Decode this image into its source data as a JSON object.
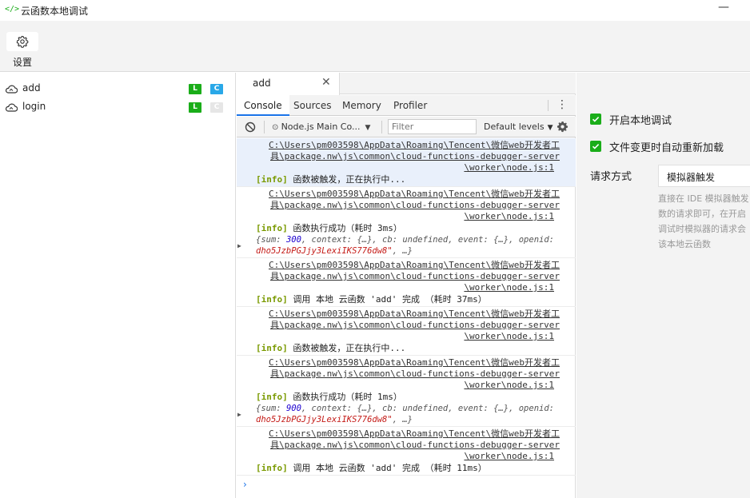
{
  "titlebar": {
    "icon": "code-bracket-icon",
    "icon_glyph": "</>",
    "title": "云函数本地调试",
    "minimize_glyph": "—"
  },
  "toolbar": {
    "settings_label": "设置",
    "settings_icon": "gear-icon"
  },
  "sidebar": {
    "functions": [
      {
        "name": "add",
        "badge_l": "L",
        "badge_c": "C",
        "c_enabled": true
      },
      {
        "name": "login",
        "badge_l": "L",
        "badge_c": "C",
        "c_enabled": false
      }
    ],
    "colors": {
      "local": "#1aad19",
      "cloud": "#29a8e8",
      "cloud_disabled": "#e6e6e6"
    }
  },
  "editor": {
    "tab_label": "add",
    "close_glyph": "✕"
  },
  "devtools": {
    "tabs": [
      "Console",
      "Sources",
      "Memory",
      "Profiler"
    ],
    "active_tab": "Console",
    "context_label": "Node.js Main Co...",
    "filter_placeholder": "Filter",
    "levels_label": "Default levels",
    "kebab_glyph": "⋮"
  },
  "console": {
    "entries": [
      {
        "src": [
          "C:\\Users\\pm003598\\AppData\\Roaming\\Tencent\\微信web开发者工",
          "具\\package.nw\\js\\common\\cloud-functions-debugger-server",
          "\\worker\\node.js:1"
        ],
        "tag": "[info]",
        "text": " 函数被触发，正在执行中...",
        "highlight": true
      },
      {
        "src": [
          "C:\\Users\\pm003598\\AppData\\Roaming\\Tencent\\微信web开发者工",
          "具\\package.nw\\js\\common\\cloud-functions-debugger-server",
          "\\worker\\node.js:1"
        ],
        "tag": "[info]",
        "text": " 函数执行成功（耗时 3ms）",
        "obj": {
          "prefix": "{sum: ",
          "sum": "300",
          "middle": ", context: {…}, cb: undefined, event: {…}, openid:",
          "openid": "dho5JzbPGJjy3LexiIKS776dw8\"",
          "suffix": ", …}",
          "quote": "\""
        }
      },
      {
        "src": [
          "C:\\Users\\pm003598\\AppData\\Roaming\\Tencent\\微信web开发者工",
          "具\\package.nw\\js\\common\\cloud-functions-debugger-server",
          "\\worker\\node.js:1"
        ],
        "tag": "[info]",
        "text": " 调用 本地 云函数 'add' 完成  （耗时 37ms）"
      },
      {
        "src": [
          "C:\\Users\\pm003598\\AppData\\Roaming\\Tencent\\微信web开发者工",
          "具\\package.nw\\js\\common\\cloud-functions-debugger-server",
          "\\worker\\node.js:1"
        ],
        "tag": "[info]",
        "text": " 函数被触发，正在执行中..."
      },
      {
        "src": [
          "C:\\Users\\pm003598\\AppData\\Roaming\\Tencent\\微信web开发者工",
          "具\\package.nw\\js\\common\\cloud-functions-debugger-server",
          "\\worker\\node.js:1"
        ],
        "tag": "[info]",
        "text": " 函数执行成功（耗时 1ms）",
        "obj": {
          "prefix": "{sum: ",
          "sum": "900",
          "middle": ", context: {…}, cb: undefined, event: {…}, openid:",
          "openid": "dho5JzbPGJjy3LexiIKS776dw8\"",
          "suffix": ", …}",
          "quote": "\""
        }
      },
      {
        "src": [
          "C:\\Users\\pm003598\\AppData\\Roaming\\Tencent\\微信web开发者工",
          "具\\package.nw\\js\\common\\cloud-functions-debugger-server",
          "\\worker\\node.js:1"
        ],
        "tag": "[info]",
        "text": " 调用 本地 云函数 'add' 完成  （耗时 11ms）"
      }
    ],
    "prompt_glyph": "›"
  },
  "right_panel": {
    "enable_local_debug": {
      "label": "开启本地调试",
      "checked": true
    },
    "auto_reload": {
      "label": "文件变更时自动重新加载",
      "checked": true
    },
    "request_method_label": "请求方式",
    "request_method_value": "模拟器触发",
    "description_lines": [
      "直接在 IDE 模拟器触发",
      "数的请求即可，在开启",
      "调试时模拟器的请求会",
      "该本地云函数"
    ],
    "accent": "#1aad19"
  }
}
